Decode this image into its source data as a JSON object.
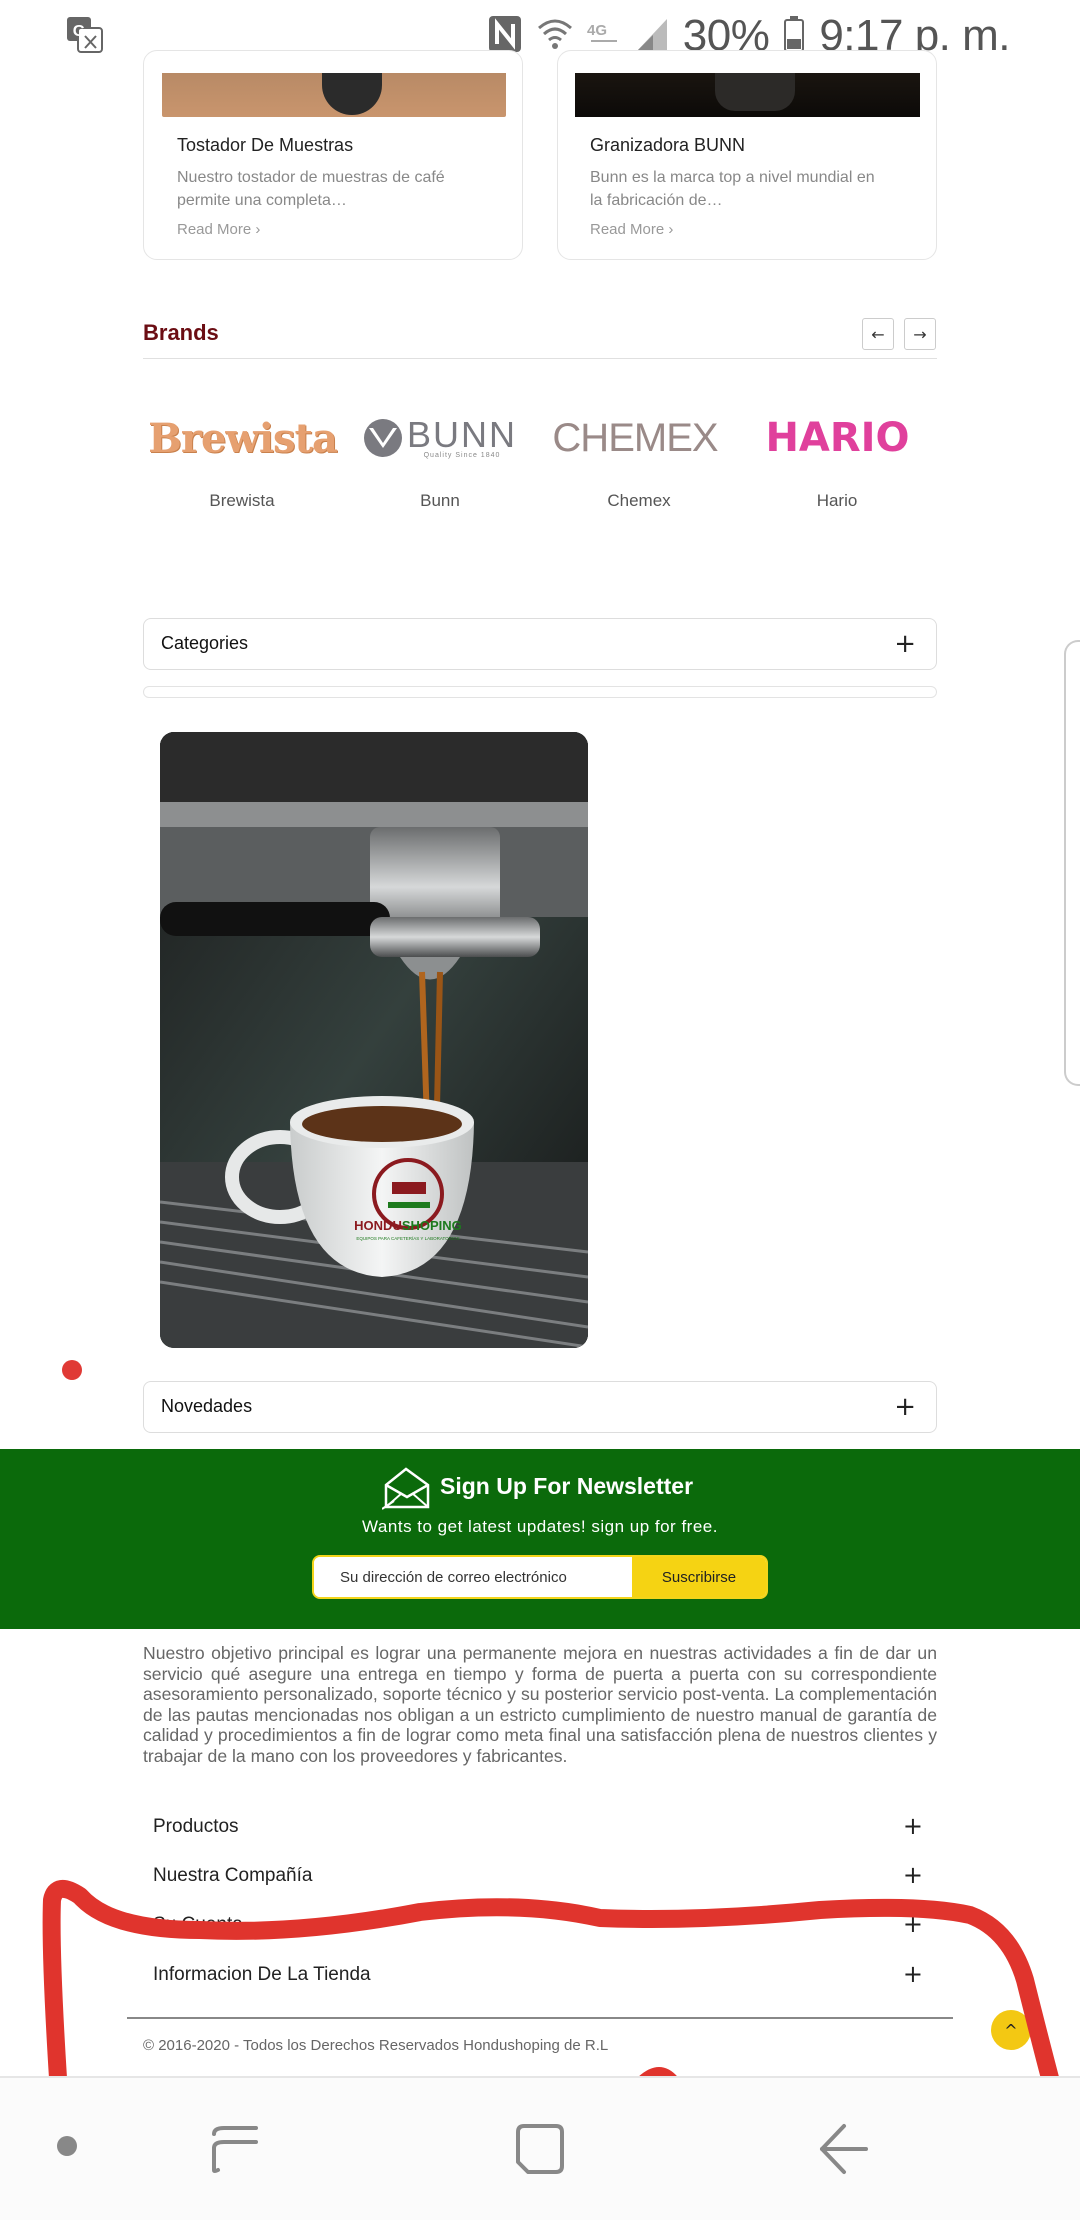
{
  "status_bar": {
    "battery": "30%",
    "time": "9:17 p. m.",
    "icons": [
      "translate-icon",
      "nfc-icon",
      "wifi-icon",
      "lte-icon",
      "signal-icon",
      "battery-icon"
    ]
  },
  "cards": [
    {
      "title": "Tostador De Muestras",
      "description_line1": "Nuestro tostador de muestras de café",
      "description_line2": "permite una completa…",
      "read_more": "Read More ›"
    },
    {
      "title": "Granizadora BUNN",
      "description_line1": "Bunn es la marca top a nivel mundial en",
      "description_line2": "la fabricación de…",
      "read_more": "Read More ›"
    }
  ],
  "brands": {
    "title": "Brands",
    "prev_label": "←",
    "next_label": "→",
    "items": [
      {
        "logo_text": "Brewista",
        "name": "Brewista",
        "color": "#e6a070"
      },
      {
        "logo_text": "BUNN",
        "logo_tagline": "Quality Since 1840",
        "name": "Bunn",
        "color": "#7a7a80"
      },
      {
        "logo_text": "CHEMEX",
        "name": "Chemex",
        "color": "#9a8a88"
      },
      {
        "logo_text": "HARIO",
        "name": "Hario",
        "color": "#e0409c"
      }
    ]
  },
  "categories": {
    "label": "Categories",
    "plus": "+"
  },
  "banner": {
    "brand_part1": "HONDU",
    "brand_part2": "SHOPING",
    "tagline": "EQUIPOS PARA CAFETERÍAS Y LABORATORIOS"
  },
  "novedades": {
    "label": "Novedades",
    "plus": "+"
  },
  "newsletter": {
    "title": "Sign Up For Newsletter",
    "subtitle": "Wants to get latest updates! sign up for free.",
    "placeholder": "Su dirección de correo electrónico",
    "button": "Suscribirse",
    "bg_color": "#0b6a0b",
    "button_color": "#f5d313"
  },
  "footer": {
    "about": "Nuestro objetivo principal es lograr una permanente mejora en nuestras actividades a fin de dar un servicio qué asegure una entrega en tiempo y forma de puerta a puerta con su correspondiente asesoramiento personalizado, soporte técnico y su posterior servicio post-venta. La complementación de las pautas mencionadas nos obligan a un estricto cumplimiento de nuestro manual de garantía de calidad y procedimientos a fin de lograr como meta final una satisfacción plena de nuestros clientes y trabajar de la mano con los proveedores y fabricantes.",
    "items": [
      {
        "label": "Productos",
        "plus": "+"
      },
      {
        "label": "Nuestra Compañía",
        "plus": "+"
      },
      {
        "label": "Su Cuenta",
        "plus": "+"
      },
      {
        "label": "Informacion De La Tienda",
        "plus": "+"
      }
    ],
    "copyright": "© 2016-2020 - Todos los Derechos Reservados Hondushoping de R.L",
    "scroll_top": "^"
  },
  "accent_color": "#6b0d13"
}
